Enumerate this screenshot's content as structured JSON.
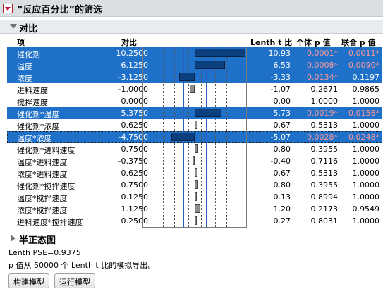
{
  "report": {
    "title": "“反应百分比”的筛选",
    "section_contrast": "对比",
    "section_halfnormal": "半正态图"
  },
  "columns": {
    "term": "项",
    "contrast": "对比",
    "lenth_t": "Lenth t 比",
    "p_individual": "个体 p 值",
    "p_simultaneous": "联合 p 值"
  },
  "rows": [
    {
      "term": "催化剂",
      "contrast": "10.2500",
      "lenth_t": "10.93",
      "p_ind": "0.0001*",
      "p_sim": "0.0011*",
      "selected": true
    },
    {
      "term": "温度",
      "contrast": "6.1250",
      "lenth_t": "6.53",
      "p_ind": "0.0008*",
      "p_sim": "0.0090*",
      "selected": true
    },
    {
      "term": "浓度",
      "contrast": "-3.1250",
      "lenth_t": "-3.33",
      "p_ind": "0.0134*",
      "p_sim": "0.1197",
      "selected": true
    },
    {
      "term": "进料速度",
      "contrast": "-1.0000",
      "lenth_t": "-1.07",
      "p_ind": "0.2671",
      "p_sim": "0.9865",
      "selected": false
    },
    {
      "term": "搅拌速度",
      "contrast": "0.0000",
      "lenth_t": "0.00",
      "p_ind": "1.0000",
      "p_sim": "1.0000",
      "selected": false
    },
    {
      "term": "催化剂*温度",
      "contrast": "5.3750",
      "lenth_t": "5.73",
      "p_ind": "0.0019*",
      "p_sim": "0.0156*",
      "selected": true
    },
    {
      "term": "催化剂*浓度",
      "contrast": "0.6250",
      "lenth_t": "0.67",
      "p_ind": "0.5313",
      "p_sim": "1.0000",
      "selected": false
    },
    {
      "term": "温度*浓度",
      "contrast": "-4.7500",
      "lenth_t": "-5.07",
      "p_ind": "0.0028*",
      "p_sim": "0.0248*",
      "selected": true
    },
    {
      "term": "催化剂*进料速度",
      "contrast": "0.7500",
      "lenth_t": "0.80",
      "p_ind": "0.3955",
      "p_sim": "1.0000",
      "selected": false
    },
    {
      "term": "温度*进料速度",
      "contrast": "-0.3750",
      "lenth_t": "-0.40",
      "p_ind": "0.7116",
      "p_sim": "1.0000",
      "selected": false
    },
    {
      "term": "浓度*进料速度",
      "contrast": "0.6250",
      "lenth_t": "0.67",
      "p_ind": "0.5313",
      "p_sim": "1.0000",
      "selected": false
    },
    {
      "term": "催化剂*搅拌速度",
      "contrast": "0.7500",
      "lenth_t": "0.80",
      "p_ind": "0.3955",
      "p_sim": "1.0000",
      "selected": false
    },
    {
      "term": "温度*搅拌速度",
      "contrast": "0.1250",
      "lenth_t": "0.13",
      "p_ind": "0.8994",
      "p_sim": "1.0000",
      "selected": false
    },
    {
      "term": "浓度*搅拌速度",
      "contrast": "1.1250",
      "lenth_t": "1.20",
      "p_ind": "0.2173",
      "p_sim": "0.9549",
      "selected": false
    },
    {
      "term": "进料速度*搅拌速度",
      "contrast": "0.2500",
      "lenth_t": "0.27",
      "p_ind": "0.8031",
      "p_sim": "1.0000",
      "selected": false
    }
  ],
  "footer": {
    "lenth_pse": "Lenth PSE=0.9375",
    "note": "p 值从 50000 个 Lenth t 比的模拟导出。",
    "btn_build": "构建模型",
    "btn_run": "运行模型"
  },
  "colors": {
    "selection": "#1e70c8",
    "significant": "#d43c3c"
  }
}
